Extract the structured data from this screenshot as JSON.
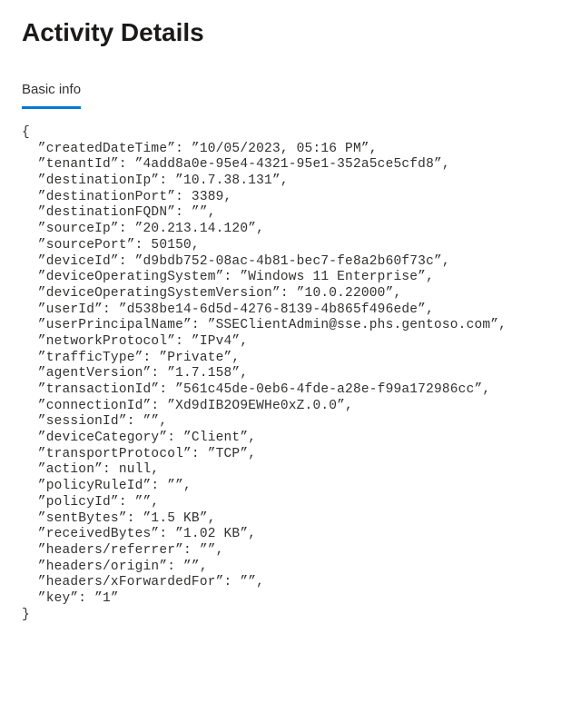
{
  "pageTitle": "Activity Details",
  "tabLabel": "Basic info",
  "jsonFields": [
    {
      "key": "createdDateTime",
      "value": "10/05/2023, 05:16 PM",
      "type": "string"
    },
    {
      "key": "tenantId",
      "value": "4add8a0e-95e4-4321-95e1-352a5ce5cfd8",
      "type": "string"
    },
    {
      "key": "destinationIp",
      "value": "10.7.38.131",
      "type": "string"
    },
    {
      "key": "destinationPort",
      "value": 3389,
      "type": "number"
    },
    {
      "key": "destinationFQDN",
      "value": "",
      "type": "string"
    },
    {
      "key": "sourceIp",
      "value": "20.213.14.120",
      "type": "string"
    },
    {
      "key": "sourcePort",
      "value": 50150,
      "type": "number"
    },
    {
      "key": "deviceId",
      "value": "d9bdb752-08ac-4b81-bec7-fe8a2b60f73c",
      "type": "string"
    },
    {
      "key": "deviceOperatingSystem",
      "value": "Windows 11 Enterprise",
      "type": "string"
    },
    {
      "key": "deviceOperatingSystemVersion",
      "value": "10.0.22000",
      "type": "string"
    },
    {
      "key": "userId",
      "value": "d538be14-6d5d-4276-8139-4b865f496ede",
      "type": "string"
    },
    {
      "key": "userPrincipalName",
      "value": "SSEClientAdmin@sse.phs.gentoso.com",
      "type": "string"
    },
    {
      "key": "networkProtocol",
      "value": "IPv4",
      "type": "string"
    },
    {
      "key": "trafficType",
      "value": "Private",
      "type": "string"
    },
    {
      "key": "agentVersion",
      "value": "1.7.158",
      "type": "string"
    },
    {
      "key": "transactionId",
      "value": "561c45de-0eb6-4fde-a28e-f99a172986cc",
      "type": "string"
    },
    {
      "key": "connectionId",
      "value": "Xd9dIB2O9EWHe0xZ.0.0",
      "type": "string"
    },
    {
      "key": "sessionId",
      "value": "",
      "type": "string"
    },
    {
      "key": "deviceCategory",
      "value": "Client",
      "type": "string"
    },
    {
      "key": "transportProtocol",
      "value": "TCP",
      "type": "string"
    },
    {
      "key": "action",
      "value": null,
      "type": "null"
    },
    {
      "key": "policyRuleId",
      "value": "",
      "type": "string"
    },
    {
      "key": "policyId",
      "value": "",
      "type": "string"
    },
    {
      "key": "sentBytes",
      "value": "1.5 KB",
      "type": "string"
    },
    {
      "key": "receivedBytes",
      "value": "1.02 KB",
      "type": "string"
    },
    {
      "key": "headers/referrer",
      "value": "",
      "type": "string"
    },
    {
      "key": "headers/origin",
      "value": "",
      "type": "string"
    },
    {
      "key": "headers/xForwardedFor",
      "value": "",
      "type": "string"
    },
    {
      "key": "key",
      "value": "1",
      "type": "string"
    }
  ]
}
